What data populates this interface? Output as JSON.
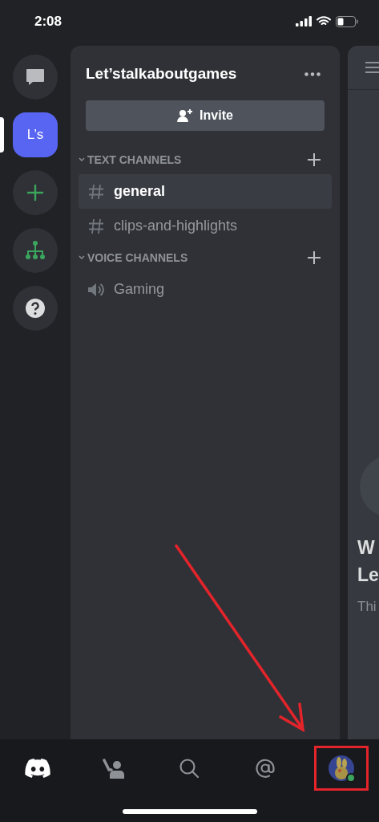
{
  "status_bar": {
    "time": "2:08"
  },
  "servers": [
    {
      "kind": "dm",
      "selected": false
    },
    {
      "kind": "server",
      "label": "L’s",
      "selected": true
    },
    {
      "kind": "add",
      "selected": false
    },
    {
      "kind": "discover",
      "selected": false
    },
    {
      "kind": "help",
      "selected": false
    }
  ],
  "server_panel": {
    "title": "Let’stalkaboutgames",
    "invite_button": "Invite",
    "categories": [
      {
        "name": "TEXT CHANNELS",
        "expanded": true,
        "channels": [
          {
            "kind": "text",
            "name": "general",
            "selected": true
          },
          {
            "kind": "text",
            "name": "clips-and-highlights",
            "selected": false
          }
        ]
      },
      {
        "name": "VOICE CHANNELS",
        "expanded": true,
        "channels": [
          {
            "kind": "voice",
            "name": "Gaming",
            "selected": false
          }
        ]
      }
    ]
  },
  "chat_preview": {
    "heading_lines": [
      "W",
      "Le"
    ],
    "subtitle": "Thi"
  },
  "bottom_nav": [
    {
      "kind": "home",
      "selected": true,
      "highlighted": false
    },
    {
      "kind": "friends",
      "selected": false,
      "highlighted": false
    },
    {
      "kind": "search",
      "selected": false,
      "highlighted": false
    },
    {
      "kind": "mentions",
      "selected": false,
      "highlighted": false
    },
    {
      "kind": "profile",
      "selected": false,
      "highlighted": true
    }
  ]
}
